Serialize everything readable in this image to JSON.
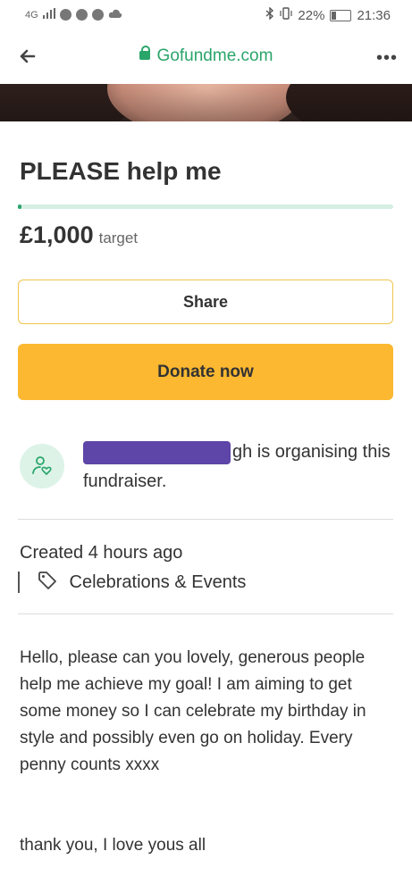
{
  "status_bar": {
    "network": "4G",
    "bluetooth_icon": "bluetooth-icon",
    "battery_percent": "22%",
    "time": "21:36"
  },
  "browser": {
    "url": "Gofundme.com",
    "menu_icon": "more-icon",
    "back_icon": "arrow-left-icon"
  },
  "campaign": {
    "title": "PLEASE help me",
    "raised_fraction": 0.0,
    "goal_amount": "£1,000",
    "goal_label": "target",
    "share_label": "Share",
    "donate_label": "Donate now"
  },
  "organiser": {
    "name_visible_fragment": "gh is organising this fundraiser."
  },
  "meta": {
    "created": "Created 4 hours ago",
    "category": "Celebrations & Events"
  },
  "story": {
    "paragraph1": "Hello, please can you lovely, generous people help me achieve my goal! I am aiming to get some money so I can celebrate my birthday in style and possibly even go on holiday. Every penny counts xxxx",
    "paragraph2": "thank you, I love yous all"
  },
  "colors": {
    "brand_green": "#2aa56a",
    "donate_yellow": "#fbb830",
    "redaction_purple": "#5e45a8"
  }
}
